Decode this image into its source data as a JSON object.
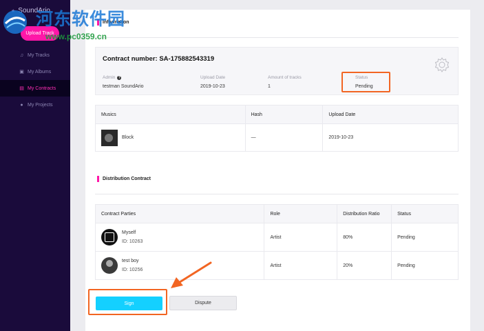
{
  "app": {
    "brand": "SoundArio"
  },
  "sidebar": {
    "upload_label": "Upload Track",
    "items": [
      {
        "label": "My Tracks",
        "icon": "music-note-icon"
      },
      {
        "label": "My Albums",
        "icon": "album-icon"
      },
      {
        "label": "My Contracts",
        "icon": "contract-icon",
        "active": true
      },
      {
        "label": "My Projects",
        "icon": "user-icon"
      }
    ]
  },
  "info": {
    "section_title": "Information",
    "contract_number": "Contract number: SA-175882543319",
    "admin_label": "Admin",
    "admin_value": "testman SoundArio",
    "upload_date_label": "Upload Date",
    "upload_date_value": "2019-10-23",
    "tracks_label": "Amount of tracks",
    "tracks_value": "1",
    "status_label": "Status",
    "status_value": "Pending"
  },
  "music_table": {
    "headers": [
      "Musics",
      "Hash",
      "Upload Date"
    ],
    "rows": [
      {
        "music": "Block",
        "hash": "—",
        "upload_date": "2019-10-23"
      }
    ]
  },
  "distribution": {
    "section_title": "Distribution Contract",
    "headers": [
      "Contract Parties",
      "Role",
      "Distribution Ratio",
      "Status"
    ],
    "rows": [
      {
        "name": "Myself",
        "id": "ID: 10263",
        "role": "Artist",
        "ratio": "80%",
        "status": "Pending"
      },
      {
        "name": "test boy",
        "id": "ID: 10256",
        "role": "Artist",
        "ratio": "20%",
        "status": "Pending"
      }
    ]
  },
  "actions": {
    "sign_label": "Sign",
    "dispute_label": "Dispute"
  },
  "watermark": {
    "title": "河东软件园",
    "url": "www.pc0359.cn"
  },
  "colors": {
    "accent": "#ff17a8",
    "sign": "#14d0ff",
    "highlight": "#f26522",
    "sidebar": "#1a0b3b"
  }
}
